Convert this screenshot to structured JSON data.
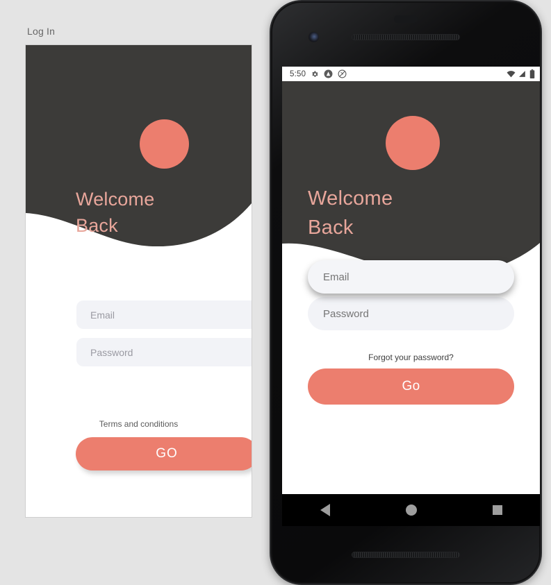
{
  "preview": {
    "label": "Log In",
    "avatar_icon": "avatar-circle",
    "welcome_line1": "Welcome",
    "welcome_line2": "Back",
    "email_placeholder": "Email",
    "password_placeholder": "Password",
    "email_value": "",
    "password_value": "",
    "terms_label": "Terms and conditions",
    "go_label": "GO"
  },
  "phone": {
    "statusbar": {
      "time": "5:50",
      "left_icons": [
        "gear-icon",
        "alert-badge-icon",
        "silent-badge-icon"
      ],
      "right_icons": [
        "wifi-icon",
        "cell-signal-icon",
        "battery-icon"
      ]
    },
    "app": {
      "avatar_icon": "avatar-circle",
      "welcome_line1": "Welcome",
      "welcome_line2": "Back",
      "email_placeholder": "Email",
      "password_placeholder": "Password",
      "email_value": "",
      "password_value": "",
      "forgot_label": "Forgot your password?",
      "go_label": "Go"
    },
    "navbar": {
      "back_icon": "back-triangle-icon",
      "home_icon": "home-circle-icon",
      "recents_icon": "recents-square-icon"
    }
  },
  "colors": {
    "accent": "#ec7e6e",
    "header_dark": "#3c3b39",
    "welcome_text": "#e8a69b",
    "field_bg": "#f2f3f7",
    "page_bg": "#e4e4e4",
    "card_bg": "#ffffff"
  }
}
